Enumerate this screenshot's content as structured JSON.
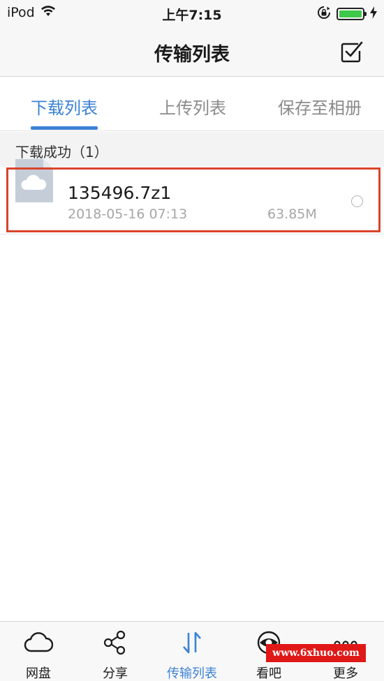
{
  "status_bar": {
    "carrier": "iPod",
    "time": "上午7:15",
    "battery_level": 1.0
  },
  "nav": {
    "title": "传输列表",
    "select_icon": "checkbox-icon"
  },
  "tabs": [
    {
      "label": "下载列表",
      "active": true
    },
    {
      "label": "上传列表",
      "active": false
    },
    {
      "label": "保存至相册",
      "active": false
    }
  ],
  "section": {
    "header": "下载成功（1）"
  },
  "files": [
    {
      "name": "135496.7z1",
      "date": "2018-05-16 07:13",
      "size": "63.85M",
      "icon": "cloud-file-icon"
    }
  ],
  "tab_bar": [
    {
      "label": "网盘",
      "icon": "cloud-icon",
      "active": false
    },
    {
      "label": "分享",
      "icon": "share-icon",
      "active": false
    },
    {
      "label": "传输列表",
      "icon": "transfer-icon",
      "active": true
    },
    {
      "label": "看吧",
      "icon": "eye-icon",
      "active": false
    },
    {
      "label": "更多",
      "icon": "more-icon",
      "active": false
    }
  ],
  "watermark": "www.6xhuo.com",
  "colors": {
    "accent": "#3b82d6",
    "highlight": "#d9442b",
    "watermark_bg": "#e01818"
  }
}
